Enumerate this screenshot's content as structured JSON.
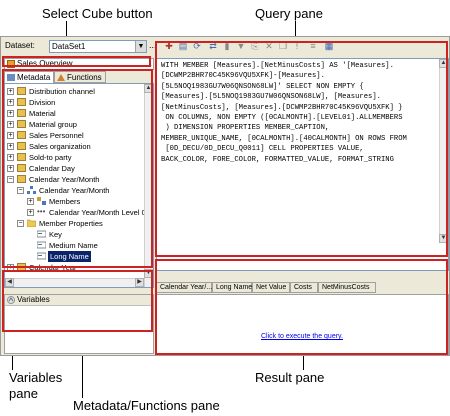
{
  "callouts": {
    "select_cube": "Select Cube button",
    "query_pane": "Query pane",
    "variables_pane": "Variables\npane",
    "result_pane": "Result pane",
    "metadata_pane": "Metadata/Functions pane"
  },
  "toolbar": {
    "dataset_label": "Dataset:",
    "dataset_value": "DataSet1",
    "browse": "..."
  },
  "cube": {
    "name": "Sales Overview",
    "more": "..."
  },
  "tabs": {
    "metadata": "Metadata",
    "functions": "Functions"
  },
  "tree": {
    "items": [
      "Distribution channel",
      "Division",
      "Material",
      "Material group",
      "Sales Personnel",
      "Sales organization",
      "Sold-to party",
      "Calendar Day",
      "Calendar Year/Month",
      "Calendar Year/Month",
      "Members",
      "Calendar Year/Month Level 0",
      "Member Properties",
      "Key",
      "Medium Name",
      "Long Name",
      "Calendar Year"
    ]
  },
  "variables": {
    "title": "Variables"
  },
  "query": {
    "text": "WITH MEMBER [Measures].[NetMinusCosts] AS '[Measures].\n[DCWMP2BHR70C45K96VQU5XFK]-[Measures].\n[5L5NOQ1983GU7W06QNSON68LW]' SELECT NON EMPTY {\n[Measures].[5L5NOQ1983GU7W06QNSON68LW], [Measures].\n[NetMinusCosts], [Measures].[DCWMP2BHR70C45K96VQU5XFK] }\n ON COLUMNS, NON EMPTY ([0CALMONTH].[LEVEL01].ALLMEMBERS\n ) DIMENSION PROPERTIES MEMBER_CAPTION,\nMEMBER_UNIQUE_NAME, [0CALMONTH].[40CALMONTH] ON ROWS FROM\n [0D_DECU/0D_DECU_Q0011] CELL PROPERTIES VALUE,\nBACK_COLOR, FORE_COLOR, FORMATTED_VALUE, FORMAT_STRING"
  },
  "result_tabs": [
    "Calendar Year/...",
    "Long Name",
    "Net Value",
    "Costs",
    "NetMinusCosts"
  ],
  "result": {
    "execute_link": "Click to execute the query."
  },
  "colors": {
    "highlight": "#cc2222",
    "selection": "#0a246a",
    "link": "#0000ee"
  }
}
